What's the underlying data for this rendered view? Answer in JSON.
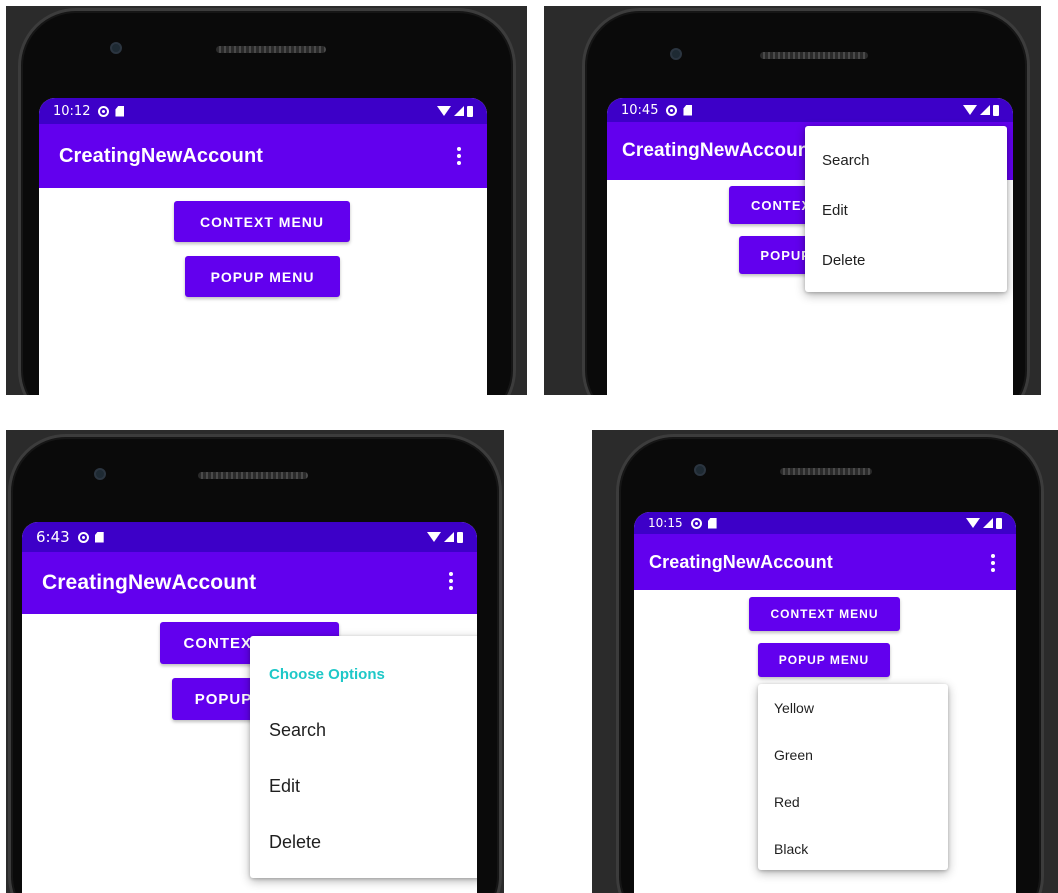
{
  "app": {
    "title": "CreatingNewAccount"
  },
  "buttons": {
    "context_menu": "CONTEXT MENU",
    "popup_menu": "POPUP MENU"
  },
  "colors": {
    "status_bar": "#3d00c8",
    "app_bar": "#6200ee",
    "button": "#6200ee",
    "menu_header": "#1ec8c8"
  },
  "panels": [
    {
      "time": "10:12"
    },
    {
      "time": "10:45",
      "menu": {
        "items": [
          "Search",
          "Edit",
          "Delete"
        ]
      }
    },
    {
      "time": "6:43",
      "menu": {
        "header": "Choose Options",
        "items": [
          "Search",
          "Edit",
          "Delete"
        ]
      }
    },
    {
      "time": "10:15",
      "menu": {
        "items": [
          "Yellow",
          "Green",
          "Red",
          "Black"
        ]
      }
    }
  ]
}
